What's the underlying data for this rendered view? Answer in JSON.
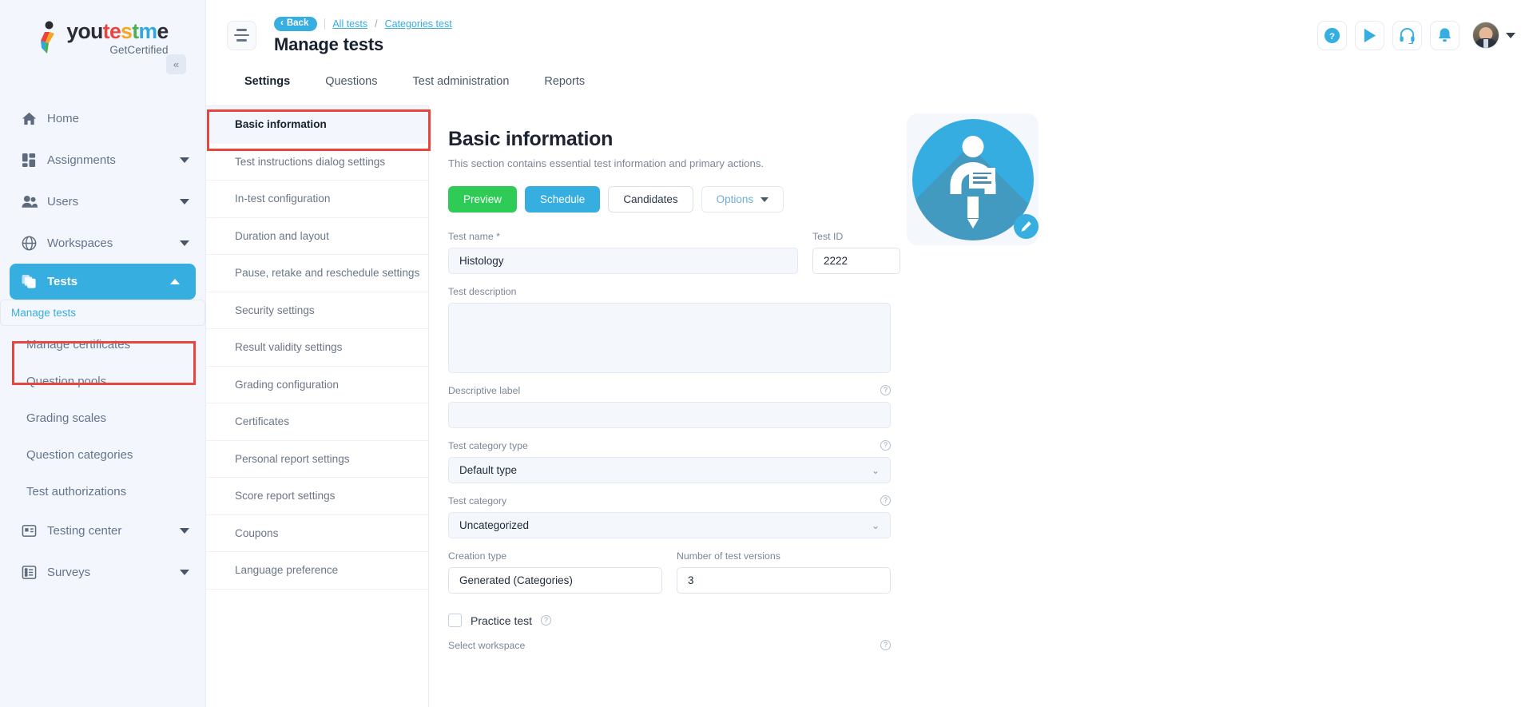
{
  "brand": {
    "name_parts": [
      "you",
      "te",
      "s",
      "t",
      "me"
    ],
    "name_full": "youtestme",
    "tagline": "GetCertified",
    "accent_blue": "#36aee0",
    "accent_green": "#2ecc57",
    "annotation_red": "#e8453c"
  },
  "sidebar": {
    "collapse_icon": "«",
    "items": [
      {
        "label": "Home",
        "icon": "home-icon",
        "expandable": false
      },
      {
        "label": "Assignments",
        "icon": "assignments-icon",
        "expandable": true
      },
      {
        "label": "Users",
        "icon": "users-icon",
        "expandable": true
      },
      {
        "label": "Workspaces",
        "icon": "globe-icon",
        "expandable": true
      },
      {
        "label": "Tests",
        "icon": "tests-icon",
        "expandable": true,
        "active": true
      }
    ],
    "tests_subitems": [
      {
        "label": "Manage tests",
        "selected": true
      },
      {
        "label": "Manage certificates",
        "selected": false
      },
      {
        "label": "Question pools",
        "selected": false
      },
      {
        "label": "Grading scales",
        "selected": false
      },
      {
        "label": "Question categories",
        "selected": false
      },
      {
        "label": "Test authorizations",
        "selected": false
      }
    ],
    "items_after": [
      {
        "label": "Testing center",
        "icon": "testing-center-icon",
        "expandable": true
      },
      {
        "label": "Surveys",
        "icon": "surveys-icon",
        "expandable": true
      }
    ]
  },
  "header": {
    "menu_icon": "hamburger-icon",
    "back_label": "Back",
    "back_chevron": "‹",
    "breadcrumb": [
      {
        "label": "All tests",
        "link": true
      },
      {
        "label": "Categories test",
        "link": true
      }
    ],
    "breadcrumb_separator": "/",
    "page_title": "Manage tests",
    "actions": [
      {
        "name": "help-icon",
        "glyph": "?"
      },
      {
        "name": "play-icon",
        "glyph": "▶"
      },
      {
        "name": "headset-support-icon",
        "glyph": "headset"
      },
      {
        "name": "notifications-bell-icon",
        "glyph": "bell"
      }
    ]
  },
  "tabs": [
    {
      "label": "Settings",
      "active": true
    },
    {
      "label": "Questions",
      "active": false
    },
    {
      "label": "Test administration",
      "active": false
    },
    {
      "label": "Reports",
      "active": false
    }
  ],
  "settings_menu": [
    {
      "label": "Basic information",
      "active": true
    },
    {
      "label": "Test instructions dialog settings",
      "active": false
    },
    {
      "label": "In-test configuration",
      "active": false
    },
    {
      "label": "Duration and layout",
      "active": false
    },
    {
      "label": "Pause, retake and reschedule settings",
      "active": false
    },
    {
      "label": "Security settings",
      "active": false
    },
    {
      "label": "Result validity settings",
      "active": false
    },
    {
      "label": "Grading configuration",
      "active": false
    },
    {
      "label": "Certificates",
      "active": false
    },
    {
      "label": "Personal report settings",
      "active": false
    },
    {
      "label": "Score report settings",
      "active": false
    },
    {
      "label": "Coupons",
      "active": false
    },
    {
      "label": "Language preference",
      "active": false
    }
  ],
  "content": {
    "heading": "Basic information",
    "subheading": "This section contains essential test information and primary actions.",
    "buttons": {
      "preview": "Preview",
      "schedule": "Schedule",
      "candidates": "Candidates",
      "options": "Options"
    },
    "fields": {
      "test_name_label": "Test name *",
      "test_name_value": "Histology",
      "test_id_label": "Test ID",
      "test_id_value": "2222",
      "test_description_label": "Test description",
      "test_description_value": "",
      "descriptive_label_label": "Descriptive label",
      "descriptive_label_value": "",
      "test_category_type_label": "Test category type",
      "test_category_type_value": "Default type",
      "test_category_label": "Test category",
      "test_category_value": "Uncategorized",
      "creation_type_label": "Creation type",
      "creation_type_value": "Generated (Categories)",
      "number_of_versions_label": "Number of test versions",
      "number_of_versions_value": "3",
      "practice_test_label": "Practice test",
      "practice_test_checked": false,
      "select_workspace_label": "Select workspace"
    },
    "help_icon_glyph": "?",
    "dropdown_chevron": "⌄",
    "test_image": {
      "name": "test-thumbnail",
      "edit_badge_icon": "pencil-edit-icon"
    }
  }
}
